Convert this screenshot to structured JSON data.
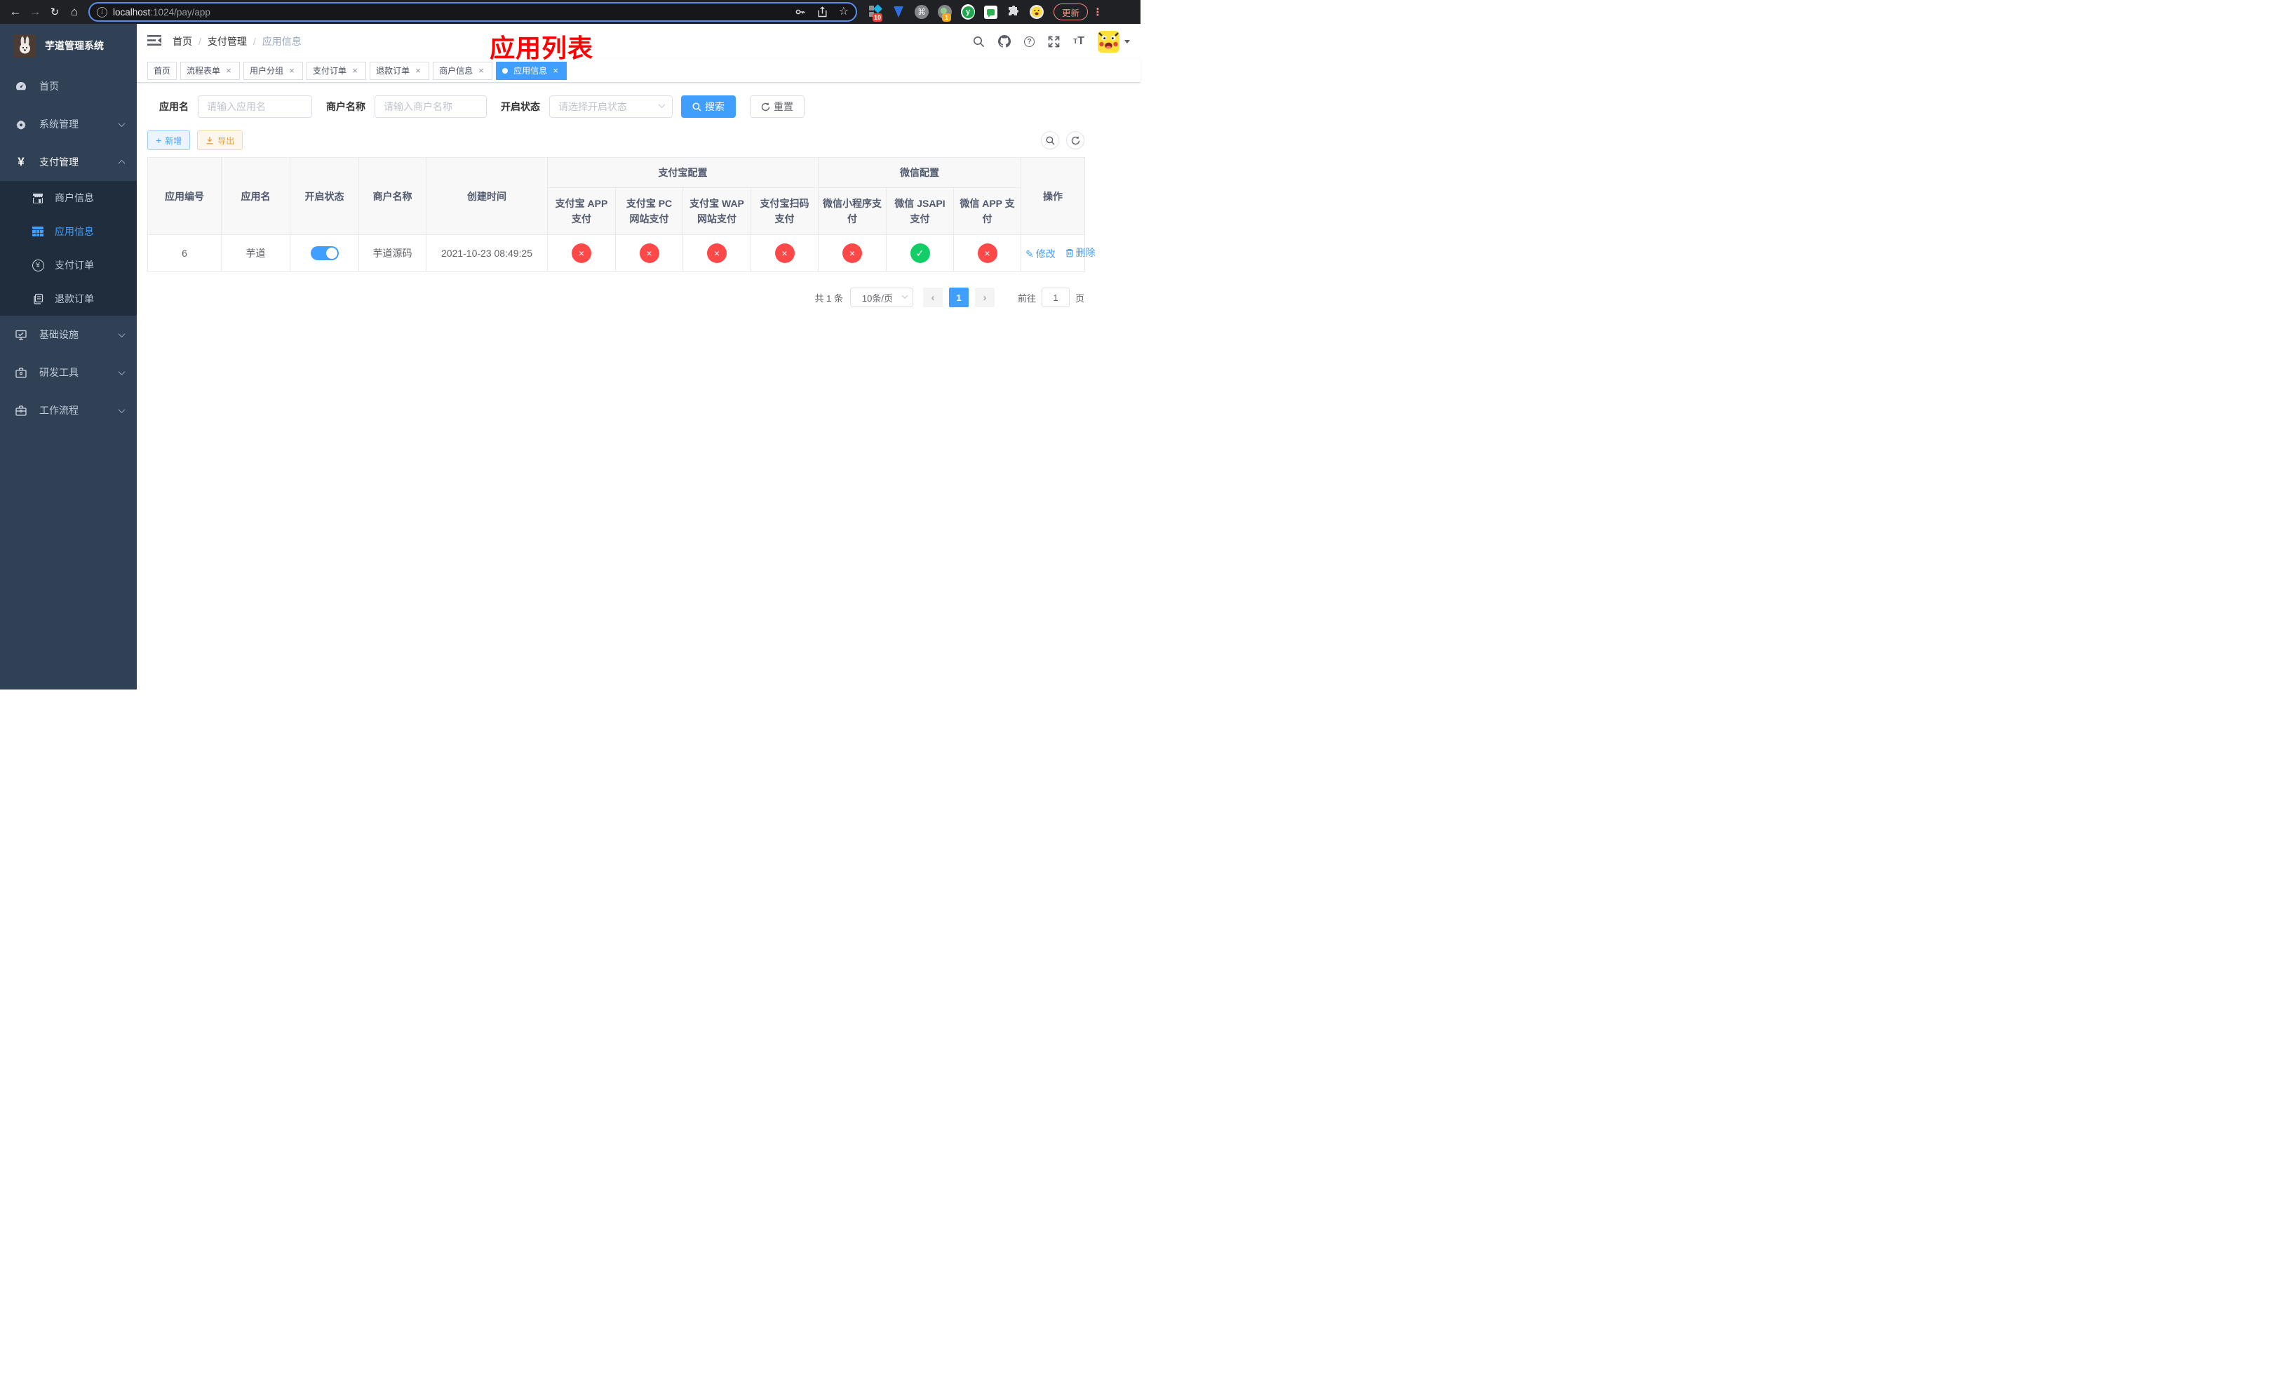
{
  "browser": {
    "url": {
      "host": "localhost",
      "rest": ":1024/pay/app"
    },
    "update_label": "更新",
    "ext_badges": {
      "blocks": "10",
      "camera": "1"
    },
    "y_ext_label": "y",
    "cmd_ext_label": "⌘"
  },
  "sidebar": {
    "logo_title": "芋道管理系统",
    "menu": [
      {
        "label": "首页"
      },
      {
        "label": "系统管理"
      },
      {
        "label": "支付管理"
      },
      {
        "label": "基础设施"
      },
      {
        "label": "研发工具"
      },
      {
        "label": "工作流程"
      }
    ],
    "submenu": [
      {
        "label": "商户信息"
      },
      {
        "label": "应用信息"
      },
      {
        "label": "支付订单"
      },
      {
        "label": "退款订单"
      }
    ]
  },
  "header": {
    "breadcrumb": [
      "首页",
      "支付管理",
      "应用信息"
    ],
    "separator": "/"
  },
  "overlay_title": "应用列表",
  "tabs": [
    {
      "label": "首页"
    },
    {
      "label": "流程表单"
    },
    {
      "label": "用户分组"
    },
    {
      "label": "支付订单"
    },
    {
      "label": "退款订单"
    },
    {
      "label": "商户信息"
    },
    {
      "label": "应用信息"
    }
  ],
  "filters": {
    "app_name": {
      "label": "应用名",
      "placeholder": "请输入应用名",
      "value": ""
    },
    "merchant": {
      "label": "商户名称",
      "placeholder": "请输入商户名称",
      "value": ""
    },
    "status": {
      "label": "开启状态",
      "placeholder": "请选择开启状态",
      "value": ""
    },
    "search_label": "搜索",
    "reset_label": "重置"
  },
  "toolbar": {
    "add_label": "新增",
    "export_label": "导出"
  },
  "table": {
    "group_headers": {
      "alipay": "支付宝配置",
      "wechat": "微信配置"
    },
    "columns": {
      "app_id": "应用编号",
      "app_name": "应用名",
      "status": "开启状态",
      "merchant": "商户名称",
      "created": "创建时间",
      "alipay_app": "支付宝 APP 支付",
      "alipay_pc": "支付宝 PC 网站支付",
      "alipay_wap": "支付宝 WAP 网站支付",
      "alipay_qr": "支付宝扫码支付",
      "wx_mini": "微信小程序支付",
      "wx_jsapi": "微信 JSAPI 支付",
      "wx_app": "微信 APP 支付",
      "actions": "操作"
    },
    "row": {
      "app_id": "6",
      "app_name": "芋道",
      "enabled": true,
      "merchant": "芋道源码",
      "created": "2021-10-23 08:49:25",
      "statuses": [
        "no",
        "no",
        "no",
        "no",
        "no",
        "yes",
        "no"
      ],
      "edit_label": "修改",
      "delete_label": "删除"
    }
  },
  "pagination": {
    "total": "共 1 条",
    "page_size": "10条/页",
    "current": "1",
    "goto_prefix": "前往",
    "goto_value": "1",
    "goto_suffix": "页"
  },
  "icons": {
    "back": "←",
    "forward": "→",
    "reload": "↻",
    "home": "⌂",
    "star": "☆",
    "close": "×",
    "check": "✓",
    "cross": "×",
    "plus": "+",
    "yen": "¥",
    "pencil": "✎",
    "question": "?",
    "dots": "⋮",
    "chev_left": "‹",
    "chev_right": "›",
    "info": "i",
    "t_small": "T",
    "t_big": "T"
  },
  "colors": {
    "accent": "#409eff",
    "success": "#13ce66",
    "danger": "#ff4949",
    "warning": "#e6a23c",
    "sidebar_bg": "#304156",
    "title_red": "#ff0000"
  }
}
